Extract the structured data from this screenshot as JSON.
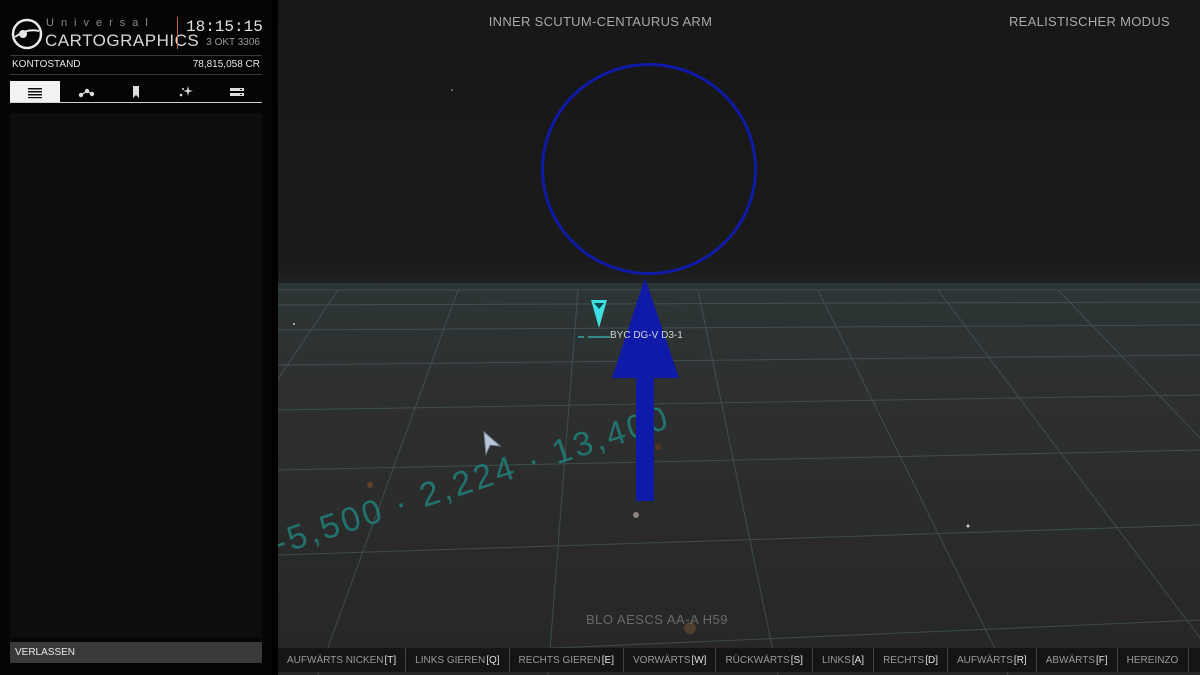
{
  "header": {
    "brand_top": "Universal",
    "brand_main": "CARTOGRAPHICS",
    "time": "18:15:15",
    "date": "3 OKT 3306"
  },
  "account": {
    "label": "KONTOSTAND",
    "value": "78,815,058 CR"
  },
  "tabs": [
    {
      "icon": "list-icon",
      "active": true
    },
    {
      "icon": "route-icon",
      "active": false
    },
    {
      "icon": "bookmark-icon",
      "active": false
    },
    {
      "icon": "sparkle-icon",
      "active": false
    },
    {
      "icon": "settings-icon",
      "active": false
    }
  ],
  "exit_label": "VERLASSEN",
  "map": {
    "region": "INNER SCUTUM-CENTAURUS ARM",
    "mode": "REALISTISCHER MODUS",
    "selected_system": "BYC      DG-V D3-1",
    "bottom_system": "BLO AESCS AA-A H59",
    "grid_numbers": "-5,500 · 2,224 · 13,400"
  },
  "colors": {
    "annotation_blue": "#101aa8",
    "marker_cyan": "#3fe0e0",
    "brand_accent": "#c26a3a"
  },
  "controls": [
    {
      "label": "AUFWÄRTS NICKEN",
      "key": "[T]"
    },
    {
      "label": "LINKS GIEREN",
      "key": "[Q]"
    },
    {
      "label": "RECHTS GIEREN",
      "key": "[E]"
    },
    {
      "label": "VORWÄRTS",
      "key": "[W]"
    },
    {
      "label": "RÜCKWÄRTS",
      "key": "[S]"
    },
    {
      "label": "LINKS",
      "key": "[A]"
    },
    {
      "label": "RECHTS",
      "key": "[D]"
    },
    {
      "label": "AUFWÄRTS",
      "key": "[R]"
    },
    {
      "label": "ABWÄRTS",
      "key": "[F]"
    },
    {
      "label": "HEREINZO",
      "key": ""
    }
  ]
}
